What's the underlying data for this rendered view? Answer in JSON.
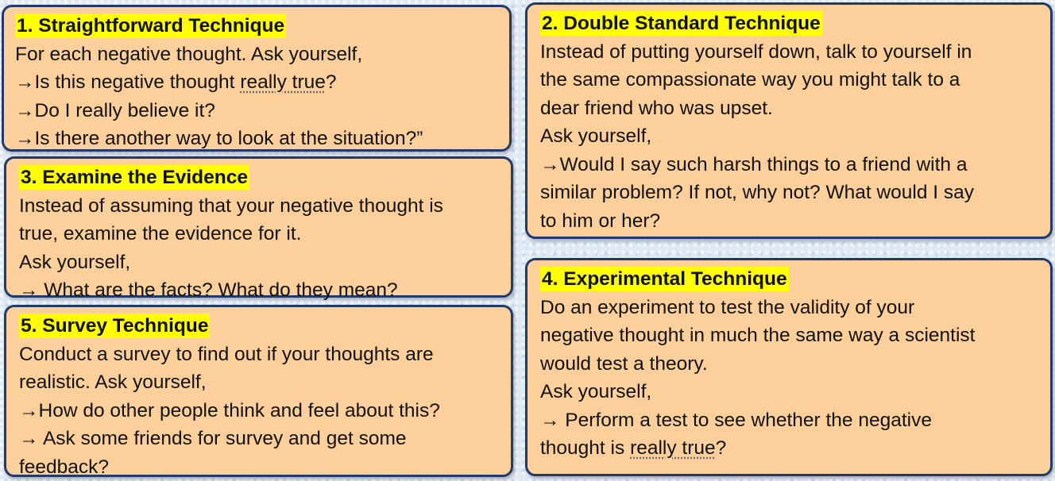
{
  "cards": {
    "straightforward": {
      "title": "1. Straightforward Technique",
      "lines": [
        "For each negative thought. Ask yourself,",
        "→Is this negative thought ",
        "really true",
        "?",
        "→Do I really believe it?",
        "→Is there another way to look at the situation?”"
      ]
    },
    "evidence": {
      "title": "3. Examine the Evidence",
      "lines": [
        "Instead of assuming that your negative thought is",
        "true, examine the evidence for it.",
        "Ask yourself,",
        "→  What are the facts? What do they mean?"
      ]
    },
    "survey": {
      "title": "5. Survey Technique",
      "lines": [
        "Conduct a survey to find out if your thoughts are",
        "realistic.  Ask yourself,",
        "→How do other people think and feel about this?",
        "→ Ask some friends for survey and get some",
        "feedback?"
      ]
    },
    "double_standard": {
      "title": "2. Double Standard Technique",
      "lines": [
        "Instead of putting yourself down, talk to yourself in",
        "the same compassionate way you might talk to a",
        "dear friend who was upset.",
        "Ask yourself,",
        "→Would I say such harsh things to a friend with a",
        "similar problem? If not, why not? What would I say",
        "to him or her?"
      ]
    },
    "experimental": {
      "title": "4. Experimental Technique",
      "lines": [
        "Do an experiment to test the validity of your",
        "negative thought in much the same way a scientist",
        "would test a theory.",
        "Ask yourself,",
        "→ Perform a test to see whether the negative",
        "thought is ",
        "really true",
        "?"
      ]
    }
  },
  "colors": {
    "card_fill": "#fdd09b",
    "card_border": "#1f3a6b",
    "title_highlight": "#ffff00"
  }
}
